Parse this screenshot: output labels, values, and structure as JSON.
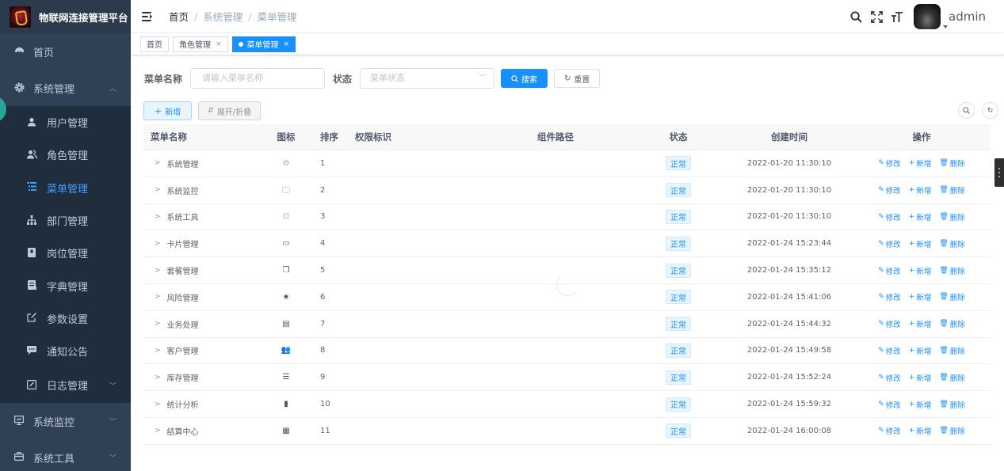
{
  "app": {
    "title": "物联网连接管理平台"
  },
  "sidebar": {
    "items": [
      {
        "label": "首页",
        "icon": "dashboard-icon"
      },
      {
        "label": "系统管理",
        "icon": "gear-icon"
      },
      {
        "label": "系统监控",
        "icon": "monitor-icon"
      },
      {
        "label": "系统工具",
        "icon": "toolbox-icon"
      }
    ],
    "submenu": [
      {
        "label": "用户管理",
        "icon": "user-icon"
      },
      {
        "label": "角色管理",
        "icon": "peoples-icon"
      },
      {
        "label": "菜单管理",
        "icon": "tree-table-icon"
      },
      {
        "label": "部门管理",
        "icon": "tree-icon"
      },
      {
        "label": "岗位管理",
        "icon": "post-icon"
      },
      {
        "label": "字典管理",
        "icon": "dict-icon"
      },
      {
        "label": "参数设置",
        "icon": "edit-icon"
      },
      {
        "label": "通知公告",
        "icon": "message-icon"
      },
      {
        "label": "日志管理",
        "icon": "log-icon"
      }
    ]
  },
  "navbar": {
    "breadcrumb": [
      "首页",
      "系统管理",
      "菜单管理"
    ],
    "user": "admin"
  },
  "tags": [
    {
      "label": "首页",
      "closable": false
    },
    {
      "label": "角色管理",
      "closable": true
    },
    {
      "label": "菜单管理",
      "closable": true,
      "active": true
    }
  ],
  "search": {
    "name_label": "菜单名称",
    "name_placeholder": "请输入菜单名称",
    "status_label": "状态",
    "status_placeholder": "菜单状态",
    "search_btn": "搜索",
    "reset_btn": "重置"
  },
  "toolbar": {
    "add": "新增",
    "expand": "展开/折叠"
  },
  "table": {
    "headers": [
      "菜单名称",
      "图标",
      "排序",
      "权限标识",
      "组件路径",
      "状态",
      "创建时间",
      "操作"
    ],
    "ops": {
      "edit": "修改",
      "add": "新增",
      "delete": "删除"
    },
    "rows": [
      {
        "name": "系统管理",
        "icon": "system-icon",
        "sort": "1",
        "status": "正常",
        "time": "2022-01-20 11:30:10"
      },
      {
        "name": "系统监控",
        "icon": "monitor-icon",
        "sort": "2",
        "status": "正常",
        "time": "2022-01-20 11:30:10"
      },
      {
        "name": "系统工具",
        "icon": "tool-icon",
        "sort": "3",
        "status": "正常",
        "time": "2022-01-20 11:30:10"
      },
      {
        "name": "卡片管理",
        "icon": "card-icon",
        "sort": "4",
        "status": "正常",
        "time": "2022-01-24 15:23:44"
      },
      {
        "name": "套餐管理",
        "icon": "package-icon",
        "sort": "5",
        "status": "正常",
        "time": "2022-01-24 15:35:12"
      },
      {
        "name": "风险管理",
        "icon": "star-icon",
        "sort": "6",
        "status": "正常",
        "time": "2022-01-24 15:41:06"
      },
      {
        "name": "业务处理",
        "icon": "document-icon",
        "sort": "7",
        "status": "正常",
        "time": "2022-01-24 15:44:32"
      },
      {
        "name": "客户管理",
        "icon": "people-icon",
        "sort": "8",
        "status": "正常",
        "time": "2022-01-24 15:49:58"
      },
      {
        "name": "库存管理",
        "icon": "list-icon",
        "sort": "9",
        "status": "正常",
        "time": "2022-01-24 15:52:24"
      },
      {
        "name": "统计分析",
        "icon": "bar-chart-icon",
        "sort": "10",
        "status": "正常",
        "time": "2022-01-24 15:59:32"
      },
      {
        "name": "结算中心",
        "icon": "table-icon",
        "sort": "11",
        "status": "正常",
        "time": "2022-01-24 16:00:08"
      }
    ]
  },
  "colors": {
    "sidebar": "#304156",
    "submenu": "#1f2d3d",
    "primary": "#1890ff",
    "active_menu": "#409eff"
  }
}
